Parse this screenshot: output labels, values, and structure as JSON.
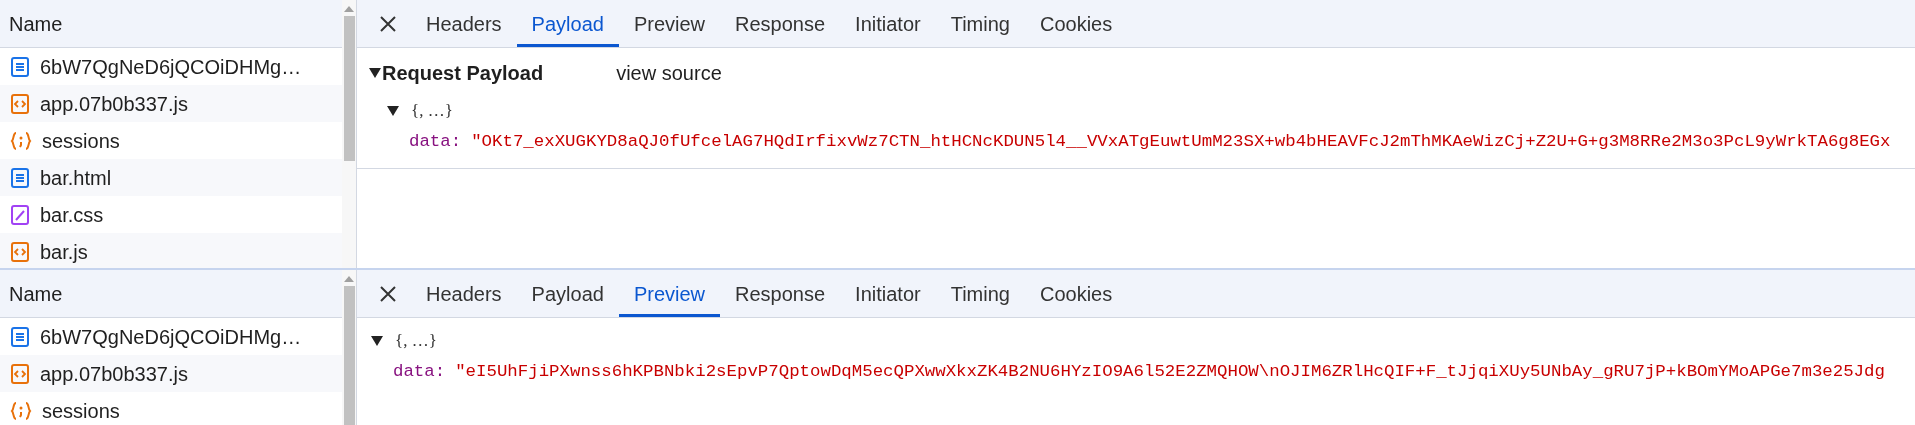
{
  "panes": [
    {
      "name_header": "Name",
      "requests": [
        {
          "name": "6bW7QgNeD6jQCOiDHMg…",
          "kind": "document"
        },
        {
          "name": "app.07b0b337.js",
          "kind": "script"
        },
        {
          "name": "sessions",
          "kind": "fetch"
        },
        {
          "name": "bar.html",
          "kind": "document"
        },
        {
          "name": "bar.css",
          "kind": "stylesheet"
        },
        {
          "name": "bar.js",
          "kind": "script"
        }
      ],
      "tabs": [
        {
          "label": "Headers",
          "selected": false
        },
        {
          "label": "Payload",
          "selected": true
        },
        {
          "label": "Preview",
          "selected": false
        },
        {
          "label": "Response",
          "selected": false
        },
        {
          "label": "Initiator",
          "selected": false
        },
        {
          "label": "Timing",
          "selected": false
        },
        {
          "label": "Cookies",
          "selected": false
        }
      ],
      "section": {
        "title": "Request Payload",
        "expanded": true,
        "view_source": "view source"
      },
      "tree": {
        "summary": "{, …}",
        "expanded": true,
        "fields": [
          {
            "key": "data:",
            "value": "\"OKt7_exXUGKYD8aQJ0fUfcelAG7HQdIrfixvWz7CTN_htHCNcKDUN5l4__VVxATgEuwtUmM23SX+wb4bHEAVFcJ2mThMKAeWizCj+Z2U+G+g3M8RRe2M3o3PcL9yWrkTA6g8EGx"
          }
        ]
      }
    },
    {
      "name_header": "Name",
      "requests": [
        {
          "name": "6bW7QgNeD6jQCOiDHMg…",
          "kind": "document"
        },
        {
          "name": "app.07b0b337.js",
          "kind": "script"
        },
        {
          "name": "sessions",
          "kind": "fetch"
        }
      ],
      "tabs": [
        {
          "label": "Headers",
          "selected": false
        },
        {
          "label": "Payload",
          "selected": false
        },
        {
          "label": "Preview",
          "selected": true
        },
        {
          "label": "Response",
          "selected": false
        },
        {
          "label": "Initiator",
          "selected": false
        },
        {
          "label": "Timing",
          "selected": false
        },
        {
          "label": "Cookies",
          "selected": false
        }
      ],
      "tree": {
        "summary": "{, …}",
        "expanded": true,
        "fields": [
          {
            "key": "data:",
            "value": "\"eI5UhFjiPXwnss6hKPBNbki2sEpvP7QptowDqM5ecQPXwwXkxZK4B2NU6HYzIO9A6l52E2ZMQHOW\\nOJIM6ZRlHcQIF+F_tJjqiXUy5UNbAy_gRU7jP+kBOmYMoAPGe7m3e25Jdg"
          }
        ]
      }
    }
  ]
}
